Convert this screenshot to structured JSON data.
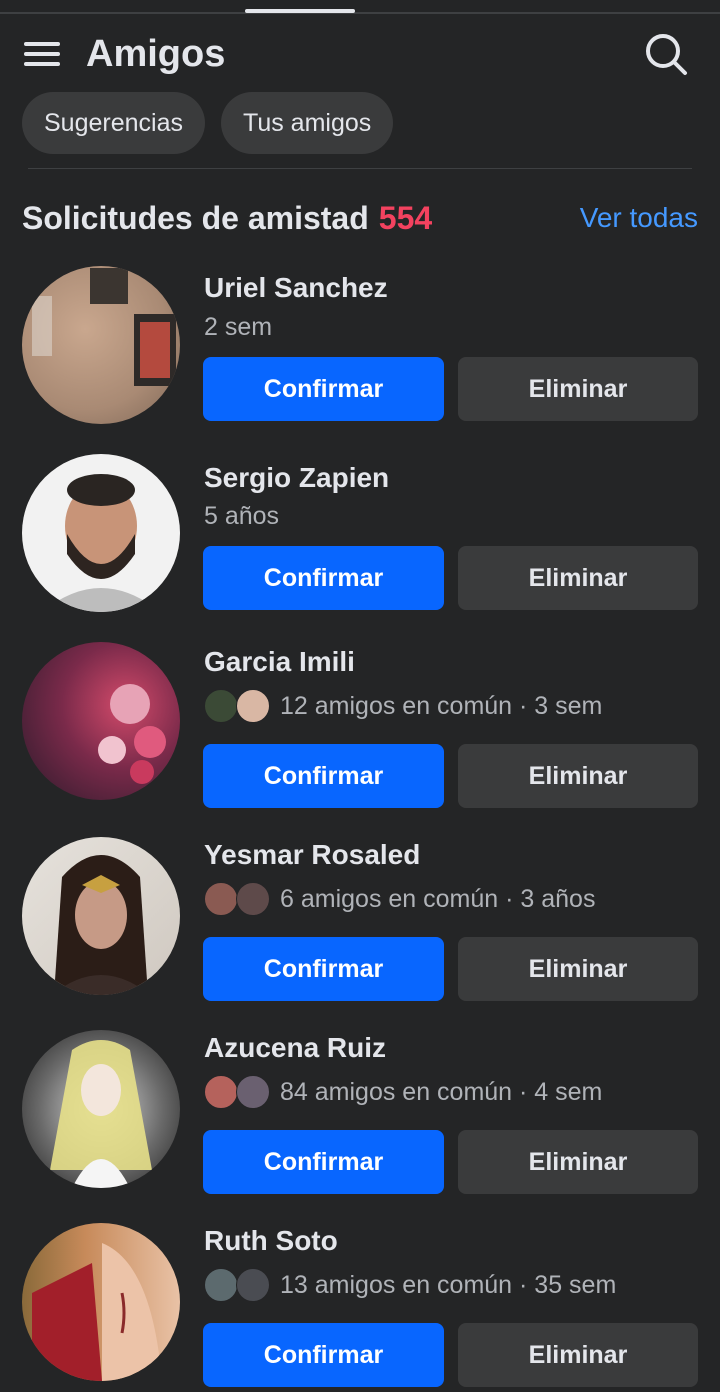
{
  "header": {
    "title": "Amigos",
    "menu_icon": "menu-icon",
    "search_icon": "search-icon"
  },
  "chips": [
    "Sugerencias",
    "Tus amigos"
  ],
  "section": {
    "title": "Solicitudes de amistad",
    "count": "554",
    "see_all": "Ver todas"
  },
  "colors": {
    "background": "#242526",
    "confirm": "#0866ff",
    "delete": "#3a3b3c",
    "count": "#f3425f",
    "link": "#4599ff"
  },
  "requests": [
    {
      "name": "Uriel Sanchez",
      "meta": "2 sem",
      "mutual": false,
      "confirm": "Confirmar",
      "delete": "Eliminar"
    },
    {
      "name": "Sergio Zapien",
      "meta": "5 años",
      "mutual": false,
      "confirm": "Confirmar",
      "delete": "Eliminar"
    },
    {
      "name": "Garcia Imili",
      "meta": "12 amigos en común · 3 sem",
      "mutual": true,
      "confirm": "Confirmar",
      "delete": "Eliminar"
    },
    {
      "name": "Yesmar Rosaled",
      "meta": "6 amigos en común · 3 años",
      "mutual": true,
      "confirm": "Confirmar",
      "delete": "Eliminar"
    },
    {
      "name": "Azucena Ruiz",
      "meta": "84 amigos en común · 4 sem",
      "mutual": true,
      "confirm": "Confirmar",
      "delete": "Eliminar"
    },
    {
      "name": "Ruth Soto",
      "meta": "13 amigos en común · 35 sem",
      "mutual": true,
      "confirm": "Confirmar",
      "delete": "Eliminar"
    }
  ]
}
